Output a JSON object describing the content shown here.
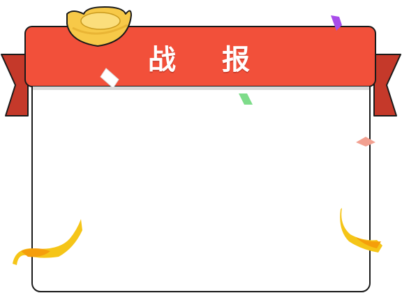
{
  "title": "战 报",
  "colors": {
    "header": "#F2503A",
    "ribbon": "#C5392A",
    "panel": "#FFFFFF",
    "outline": "#1A1A1A",
    "gold": "#F7C948",
    "confetti_purple": "#A84BEA",
    "confetti_green": "#7EDC8A",
    "confetti_pink": "#F2A090",
    "streamer_yellow": "#F5C518"
  },
  "icons": {
    "ingot": "gold-ingot-icon"
  }
}
